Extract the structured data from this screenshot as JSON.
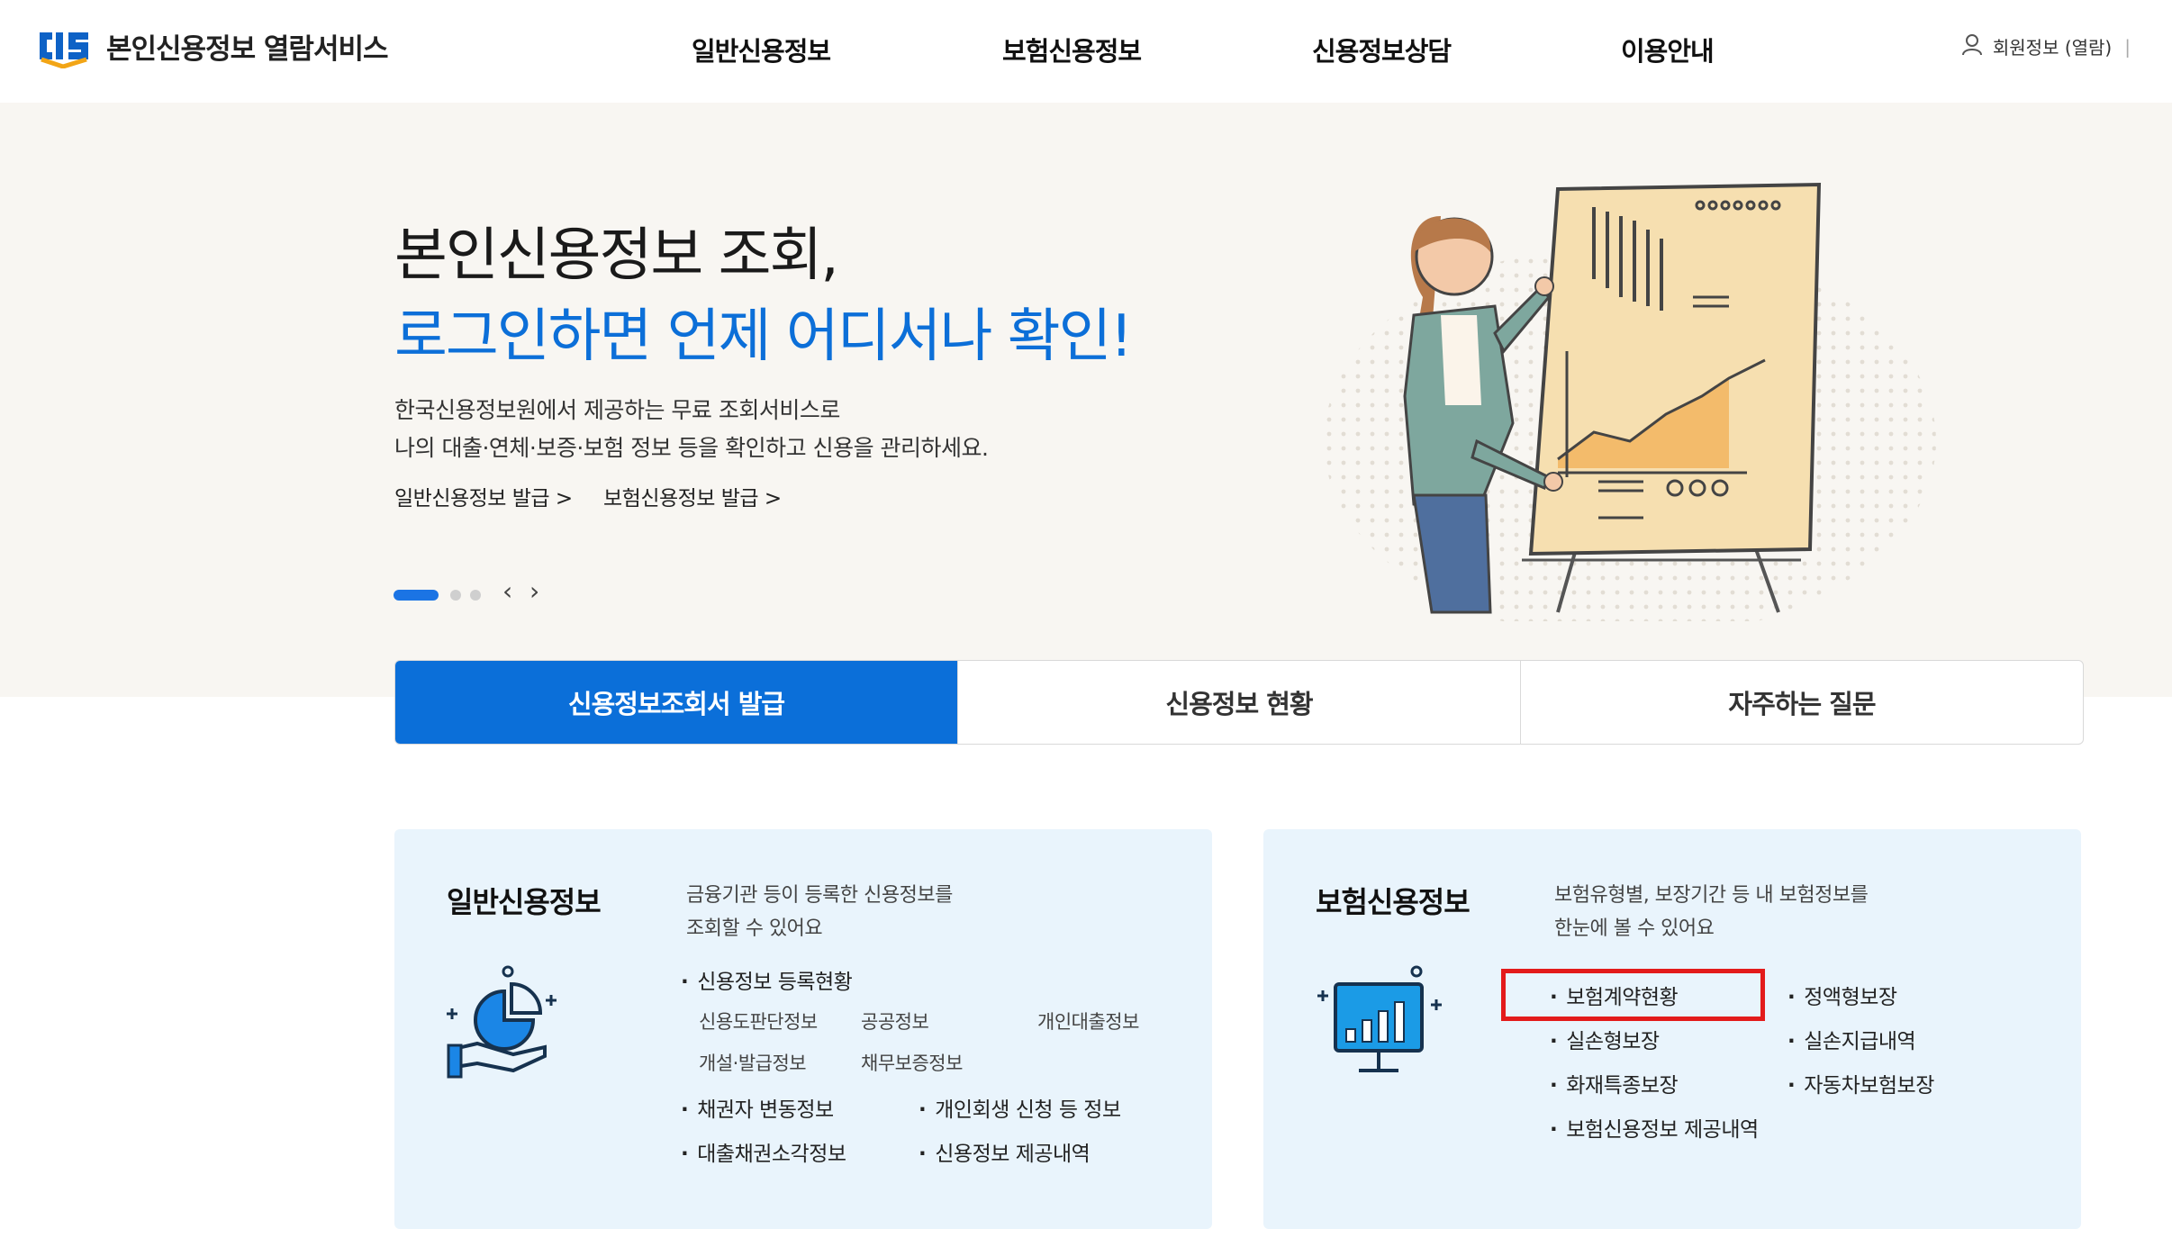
{
  "header": {
    "logo_text": "본인신용정보 열람서비스",
    "nav": [
      "일반신용정보",
      "보험신용정보",
      "신용정보상담",
      "이용안내"
    ],
    "user_label": "회원정보 (열람)",
    "user_sep": "|"
  },
  "hero": {
    "title_line1": "본인신용정보 조회,",
    "title_line2": "로그인하면 언제 어디서나 확인!",
    "desc_line1": "한국신용정보원에서 제공하는 무료 조회서비스로",
    "desc_line2": "나의 대출·연체·보증·보험 정보 등을 확인하고 신용을 관리하세요.",
    "link1": "일반신용정보 발급 >",
    "link2": "보험신용정보 발급 >",
    "prev": "‹",
    "next": "›"
  },
  "tabs": [
    {
      "label": "신용정보조회서 발급",
      "active": true
    },
    {
      "label": "신용정보 현황",
      "active": false
    },
    {
      "label": "자주하는 질문",
      "active": false
    }
  ],
  "general_card": {
    "title": "일반신용정보",
    "desc_line1": "금융기관 등이 등록한 신용정보를",
    "desc_line2": "조회할 수 있어요",
    "registered": "신용정보 등록현황",
    "sub_items": [
      "신용도판단정보",
      "공공정보",
      "개인대출정보",
      "개설·발급정보",
      "채무보증정보"
    ],
    "items": [
      "채권자 변동정보",
      "개인회생 신청 등 정보",
      "대출채권소각정보",
      "신용정보 제공내역"
    ]
  },
  "insurance_card": {
    "title": "보험신용정보",
    "desc_line1": "보험유형별, 보장기간 등 내 보험정보를",
    "desc_line2": "한눈에 볼 수 있어요",
    "items": [
      "보험계약현황",
      "정액형보장",
      "실손형보장",
      "실손지급내역",
      "화재특종보장",
      "자동차보험보장",
      "보험신용정보 제공내역"
    ]
  },
  "colors": {
    "brand_blue": "#0b6fd9",
    "hero_bg": "#f8f6f2",
    "card_bg": "#e9f4fc",
    "highlight_red": "#e31b1b"
  }
}
